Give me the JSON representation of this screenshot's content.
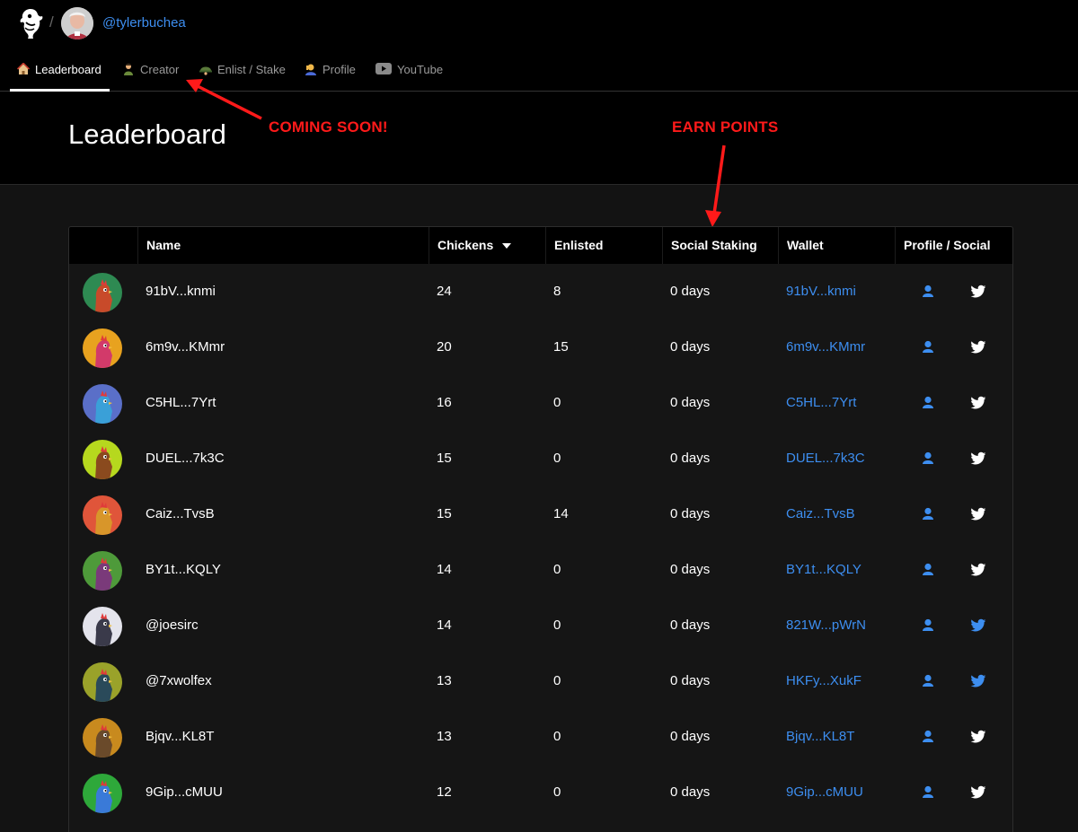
{
  "header": {
    "username": "@tylerbuchea",
    "separator": "/"
  },
  "tabs": [
    {
      "label": "Leaderboard",
      "icon": "house-icon",
      "active": true
    },
    {
      "label": "Creator",
      "icon": "artist-icon",
      "active": false
    },
    {
      "label": "Enlist / Stake",
      "icon": "helmet-icon",
      "active": false
    },
    {
      "label": "Profile",
      "icon": "person-icon",
      "active": false
    },
    {
      "label": "YouTube",
      "icon": "youtube-icon",
      "active": false
    }
  ],
  "page": {
    "title": "Leaderboard"
  },
  "annotations": {
    "coming_soon": "COMING SOON!",
    "earn_points": "EARN POINTS"
  },
  "table": {
    "columns": [
      "",
      "Name",
      "Chickens",
      "Enlisted",
      "Social Staking",
      "Wallet",
      "Profile / Social"
    ],
    "sorted_column": "Chickens",
    "rows": [
      {
        "name": "91bV...knmi",
        "chickens": "24",
        "enlisted": "8",
        "staking": "0 days",
        "wallet": "91bV...knmi",
        "twitter_active": false,
        "bg": "#2e8a52",
        "fg": "#c84a2a"
      },
      {
        "name": "6m9v...KMmr",
        "chickens": "20",
        "enlisted": "15",
        "staking": "0 days",
        "wallet": "6m9v...KMmr",
        "twitter_active": false,
        "bg": "#e8a21f",
        "fg": "#d23a6a"
      },
      {
        "name": "C5HL...7Yrt",
        "chickens": "16",
        "enlisted": "0",
        "staking": "0 days",
        "wallet": "C5HL...7Yrt",
        "twitter_active": false,
        "bg": "#5a6fc8",
        "fg": "#3aa0d8"
      },
      {
        "name": "DUEL...7k3C",
        "chickens": "15",
        "enlisted": "0",
        "staking": "0 days",
        "wallet": "DUEL...7k3C",
        "twitter_active": false,
        "bg": "#b6d81e",
        "fg": "#8a4a1e"
      },
      {
        "name": "Caiz...TvsB",
        "chickens": "15",
        "enlisted": "14",
        "staking": "0 days",
        "wallet": "Caiz...TvsB",
        "twitter_active": false,
        "bg": "#e0553a",
        "fg": "#d8962a"
      },
      {
        "name": "BY1t...KQLY",
        "chickens": "14",
        "enlisted": "0",
        "staking": "0 days",
        "wallet": "BY1t...KQLY",
        "twitter_active": false,
        "bg": "#4e9a3a",
        "fg": "#7a3a7a"
      },
      {
        "name": "@joesirc",
        "chickens": "14",
        "enlisted": "0",
        "staking": "0 days",
        "wallet": "821W...pWrN",
        "twitter_active": true,
        "bg": "#e4e4ec",
        "fg": "#3a3a4a"
      },
      {
        "name": "@7xwolfex",
        "chickens": "13",
        "enlisted": "0",
        "staking": "0 days",
        "wallet": "HKFy...XukF",
        "twitter_active": true,
        "bg": "#9aa22a",
        "fg": "#2a4a5a"
      },
      {
        "name": "Bjqv...KL8T",
        "chickens": "13",
        "enlisted": "0",
        "staking": "0 days",
        "wallet": "Bjqv...KL8T",
        "twitter_active": false,
        "bg": "#c88a1e",
        "fg": "#6a4a2a"
      },
      {
        "name": "9Gip...cMUU",
        "chickens": "12",
        "enlisted": "0",
        "staking": "0 days",
        "wallet": "9Gip...cMUU",
        "twitter_active": false,
        "bg": "#2ea83a",
        "fg": "#3a7ad8"
      }
    ]
  },
  "colors": {
    "link": "#3d8ef0",
    "annotation": "#ff1a1a",
    "background": "#131313",
    "header_bg": "#000000"
  }
}
